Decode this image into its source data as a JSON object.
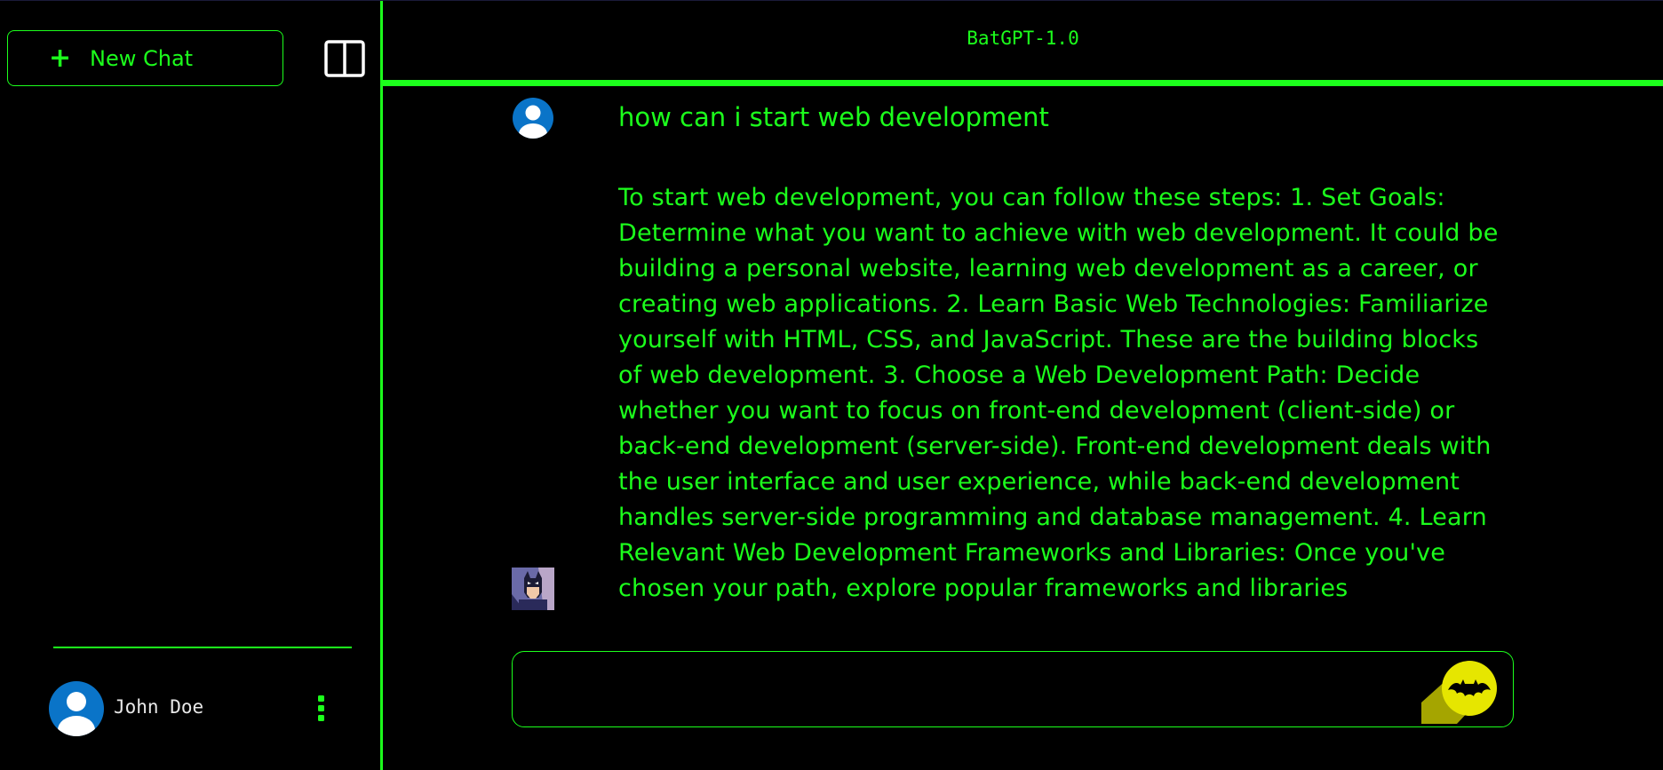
{
  "sidebar": {
    "new_chat_label": "New Chat",
    "user": {
      "name": "John Doe"
    }
  },
  "header": {
    "title": "BatGPT-1.0"
  },
  "chat": {
    "user_message": "how can i start web development",
    "bot_message": "To start web development, you can follow these steps: 1. Set Goals: Determine what you want to achieve with web development. It could be building a personal website, learning web development as a career, or creating web applications. 2. Learn Basic Web Technologies: Familiarize yourself with HTML, CSS, and JavaScript. These are the building blocks of web development. 3. Choose a Web Development Path: Decide whether you want to focus on front-end development (client-side) or back-end development (server-side). Front-end development deals with the user interface and user experience, while back-end development handles server-side programming and database management. 4. Learn Relevant Web Development Frameworks and Libraries: Once you've chosen your path, explore popular frameworks and libraries"
  },
  "input": {
    "placeholder": "",
    "value": ""
  },
  "colors": {
    "accent": "#1cff1c",
    "background": "#000000",
    "avatar_blue": "#0a74c8",
    "send_yellow": "#e6e600"
  },
  "icons": {
    "new_chat": "plus-icon",
    "toggle": "sidebar-toggle-icon",
    "user": "user-avatar-icon",
    "menu": "kebab-menu-icon",
    "bot": "batman-avatar-icon",
    "send": "bat-signal-icon"
  }
}
